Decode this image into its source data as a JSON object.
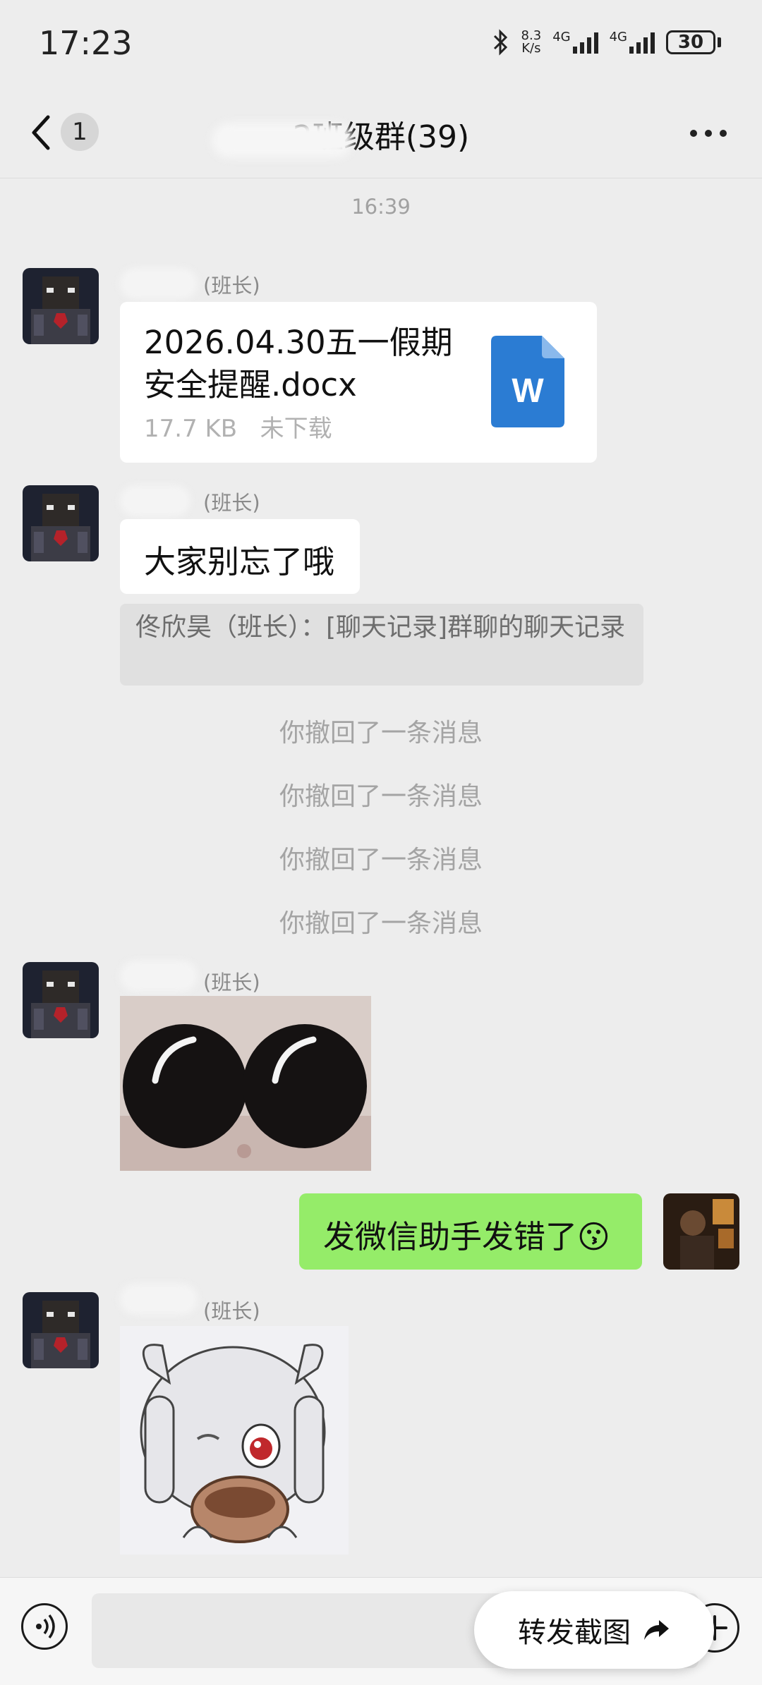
{
  "status_bar": {
    "time": "17:23",
    "speed_value": "8.3",
    "speed_unit": "K/s",
    "net1": "4G",
    "net2": "4G",
    "battery": "30"
  },
  "header": {
    "unread_count": "1",
    "title": "2班级群(39)"
  },
  "messages": {
    "timestamp": "16:39",
    "msg1": {
      "role": "(班长)",
      "file_name": "2026.04.30五一假期安全提醒.docx",
      "file_size": "17.7 KB",
      "file_status": "未下载",
      "file_icon_letter": "W"
    },
    "msg2": {
      "role": "(班长)",
      "text": "大家别忘了哦",
      "quote": "佟欣昊（班长）：[聊天记录]群聊的聊天记录"
    },
    "recalls": [
      "你撤回了一条消息",
      "你撤回了一条消息",
      "你撤回了一条消息",
      "你撤回了一条消息"
    ],
    "msg3": {
      "role": "(班长)"
    },
    "msg_me": {
      "text": "发微信助手发错了",
      "emoji": "😗"
    },
    "msg4": {
      "role": "(班长)"
    }
  },
  "bottom": {
    "forward_label": "转发截图"
  },
  "colors": {
    "background": "#ededed",
    "my_bubble": "#95ec69",
    "word_blue": "#2b7cd3"
  }
}
